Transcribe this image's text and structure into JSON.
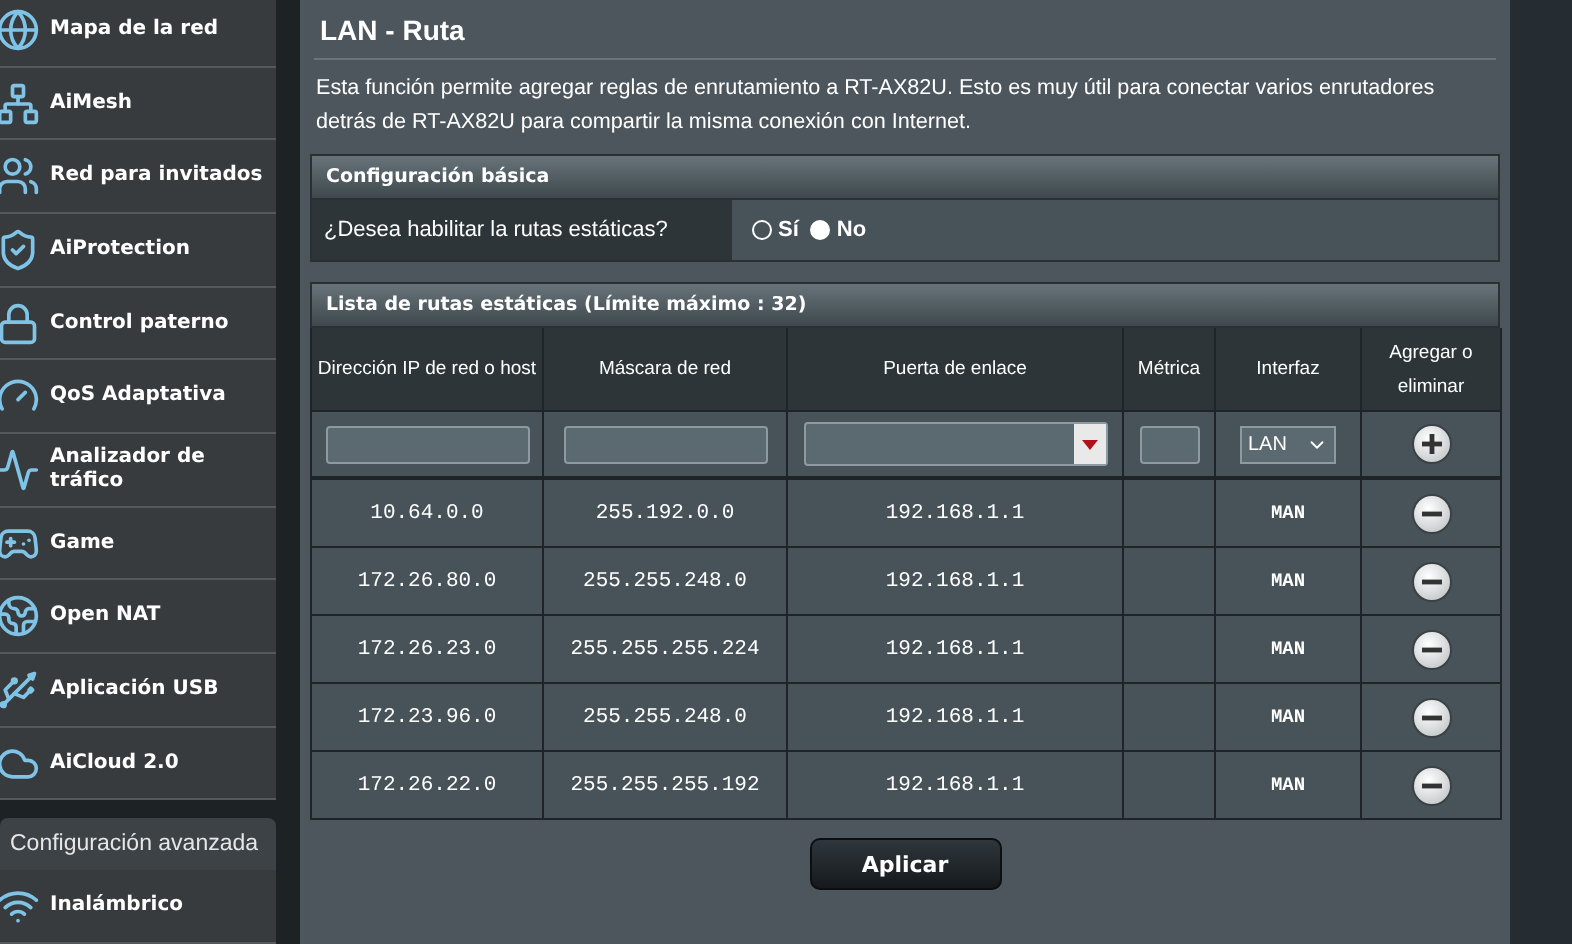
{
  "sidebar": {
    "items": [
      {
        "label": "Mapa de la red"
      },
      {
        "label": "AiMesh"
      },
      {
        "label": "Red para invitados"
      },
      {
        "label": "AiProtection"
      },
      {
        "label": "Control paterno"
      },
      {
        "label": "QoS Adaptativa"
      },
      {
        "label": "Analizador de tráfico"
      },
      {
        "label": "Game"
      },
      {
        "label": "Open NAT"
      },
      {
        "label": "Aplicación USB"
      },
      {
        "label": "AiCloud 2.0"
      }
    ],
    "section_title": "Configuración avanzada",
    "advanced_items": [
      {
        "label": "Inalámbrico"
      }
    ]
  },
  "page": {
    "title": "LAN - Ruta",
    "description": "Esta función permite agregar reglas de enrutamiento a RT-AX82U. Esto es muy útil para conectar varios enrutadores detrás de RT-AX82U para compartir la misma conexión con Internet."
  },
  "basic": {
    "header": "Configuración básica",
    "question": "¿Desea habilitar la rutas estáticas?",
    "options": [
      {
        "label": "Sí",
        "selected": false
      },
      {
        "label": "No",
        "selected": true
      }
    ]
  },
  "routes": {
    "header": "Lista de rutas estáticas (Límite máximo : 32)",
    "columns": [
      "Dirección IP de red o host",
      "Máscara de red",
      "Puerta de enlace",
      "Métrica",
      "Interfaz",
      "Agregar o eliminar"
    ],
    "new_route": {
      "interface": "LAN"
    },
    "rows": [
      {
        "ip": "10.64.0.0",
        "mask": "255.192.0.0",
        "gateway": "192.168.1.1",
        "interface": "MAN"
      },
      {
        "ip": "172.26.80.0",
        "mask": "255.255.248.0",
        "gateway": "192.168.1.1",
        "interface": "MAN"
      },
      {
        "ip": "172.26.23.0",
        "mask": "255.255.255.224",
        "gateway": "192.168.1.1",
        "interface": "MAN"
      },
      {
        "ip": "172.23.96.0",
        "mask": "255.255.248.0",
        "gateway": "192.168.1.1",
        "interface": "MAN"
      },
      {
        "ip": "172.26.22.0",
        "mask": "255.255.255.192",
        "gateway": "192.168.1.1",
        "interface": "MAN"
      }
    ]
  },
  "apply_button": "Aplicar"
}
